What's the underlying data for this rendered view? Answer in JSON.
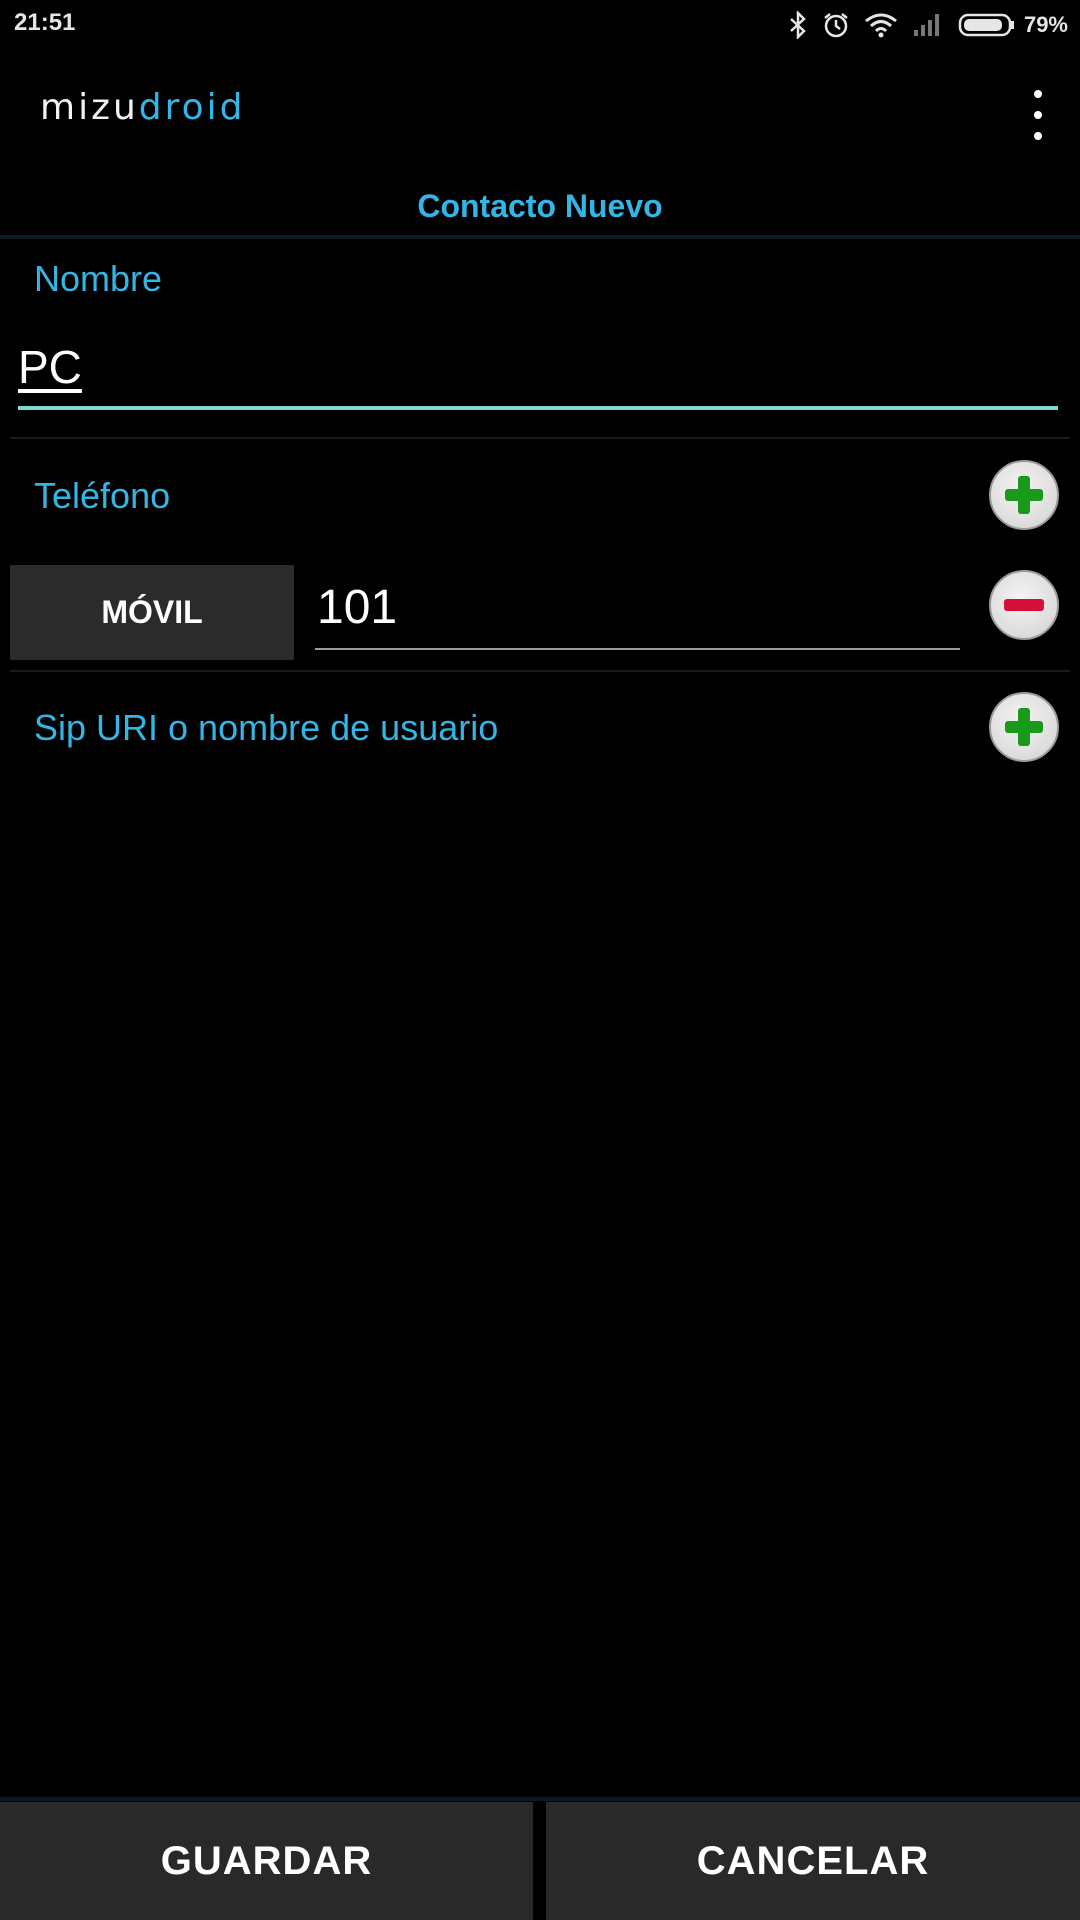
{
  "status_bar": {
    "time": "21:51",
    "battery_percent": "79%",
    "icons": [
      "bluetooth-icon",
      "alarm-icon",
      "wifi-icon",
      "signal-icon",
      "battery-icon"
    ]
  },
  "app_bar": {
    "logo_part1": "mizu",
    "logo_part2": "droid",
    "menu_icon": "overflow-menu-icon"
  },
  "screen": {
    "title": "Contacto Nuevo"
  },
  "form": {
    "name_label": "Nombre",
    "name_value": "PC",
    "phone_label": "Teléfono",
    "phone_type": "MÓVIL",
    "phone_value": "101",
    "sip_label": "Sip URI o nombre de usuario"
  },
  "actions": {
    "save_label": "GUARDAR",
    "cancel_label": "CANCELAR"
  },
  "colors": {
    "accent": "#33b5e5",
    "add": "#1a9a1a",
    "remove": "#d4103a",
    "input_focus": "#7ed6cd"
  }
}
